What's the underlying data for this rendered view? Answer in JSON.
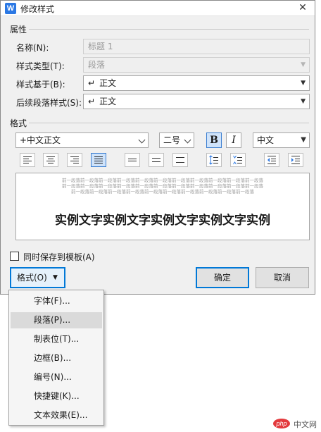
{
  "window": {
    "title": "修改样式",
    "icon_letter": "W",
    "close_glyph": "✕"
  },
  "properties": {
    "group_label": "属性",
    "name_label": "名称(N):",
    "name_value": "标题 1",
    "type_label": "样式类型(T):",
    "type_value": "段落",
    "based_on_label": "样式基于(B):",
    "based_on_value": "正文",
    "next_label": "后续段落样式(S):",
    "next_value": "正文",
    "paragraph_symbol": "↵"
  },
  "format": {
    "group_label": "格式",
    "font_value": "+中文正文",
    "size_value": "二号",
    "bold_label": "B",
    "italic_label": "I",
    "language_value": "中文"
  },
  "preview": {
    "prev_paragraph_lines": [
      "前一段落前一段落前一段落前一段落前一段落前一段落前一段落前一段落前一段落前一段落前一段落",
      "前一段落前一段落前一段落前一段落前一段落前一段落前一段落前一段落前一段落前一段落前一段落",
      "前一段落前一段落前一段落前一段落前一段落前一段落前一段落前一段落前一段落前一段落"
    ],
    "sample_text": "实例文字实例文字实例文字实例文字实例"
  },
  "template_checkbox": {
    "label": "同时保存到模板(A)",
    "checked": false
  },
  "buttons": {
    "format_label": "格式(O)",
    "ok_label": "确定",
    "cancel_label": "取消",
    "dropdown_arrow": "▼"
  },
  "format_menu": {
    "items": [
      "字体(F)...",
      "段落(P)...",
      "制表位(T)...",
      "边框(B)...",
      "编号(N)...",
      "快捷键(K)...",
      "文本效果(E)..."
    ],
    "highlighted": "段落(P)..."
  },
  "watermark": {
    "logo": "php",
    "text": "中文网"
  },
  "colors": {
    "accent": "#0078d7",
    "active_fill": "#cfe3fa",
    "dialog_bg": "#f0f0f0"
  }
}
